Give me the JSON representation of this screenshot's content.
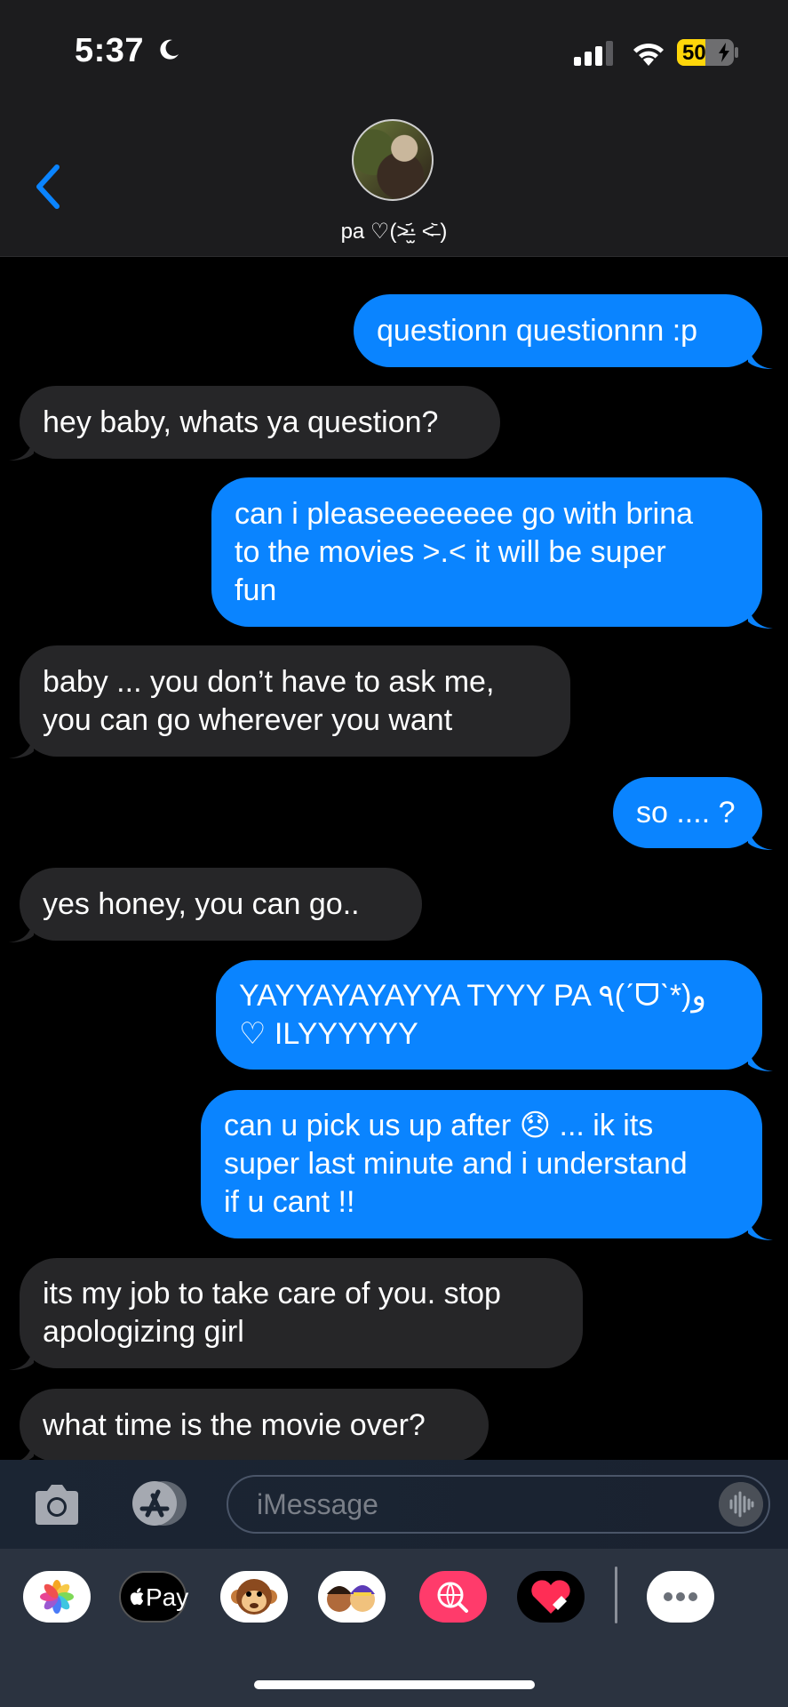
{
  "status_bar": {
    "time": "5:37",
    "battery": "50",
    "battery_percent": 50,
    "icons": [
      "moon-icon",
      "cellular-signal-icon",
      "wifi-icon",
      "battery-charging-icon"
    ]
  },
  "header": {
    "contact_name": "pa ♡(˃̶᷄‧̫ ˂̶᷅ )",
    "back_icon": "chevron-left-icon"
  },
  "messages": [
    {
      "dir": "out",
      "text": "questionn questionnn :p"
    },
    {
      "dir": "in",
      "text": "hey baby, whats ya question?"
    },
    {
      "dir": "out",
      "text": "can i pleaseeeeeeee go with brina\nto the movies  >.<  it will be super\nfun"
    },
    {
      "dir": "in",
      "text": "baby ... you don’t have to ask me,\nyou can go wherever you want"
    },
    {
      "dir": "out",
      "text": "so .... ?"
    },
    {
      "dir": "in",
      "text": "yes honey, you can go.."
    },
    {
      "dir": "out",
      "text": "YAYYAYAYAYYA TYYY PA ٩(ˊᗜˋ*)و\n♡ ILYYYYYY"
    },
    {
      "dir": "out",
      "text": "can u pick us up after 😞 ... ik its\nsuper last minute and i understand\nif u cant !!"
    },
    {
      "dir": "in",
      "text": "its my job to take care of you. stop\napologizing girl"
    },
    {
      "dir": "in",
      "text": "what time is the movie over?"
    }
  ],
  "composer": {
    "placeholder": "iMessage"
  },
  "app_tray": {
    "apple_pay_label": "Pay"
  },
  "colors": {
    "outgoing": "#0a84ff",
    "incoming": "#262628",
    "background": "#000000"
  }
}
